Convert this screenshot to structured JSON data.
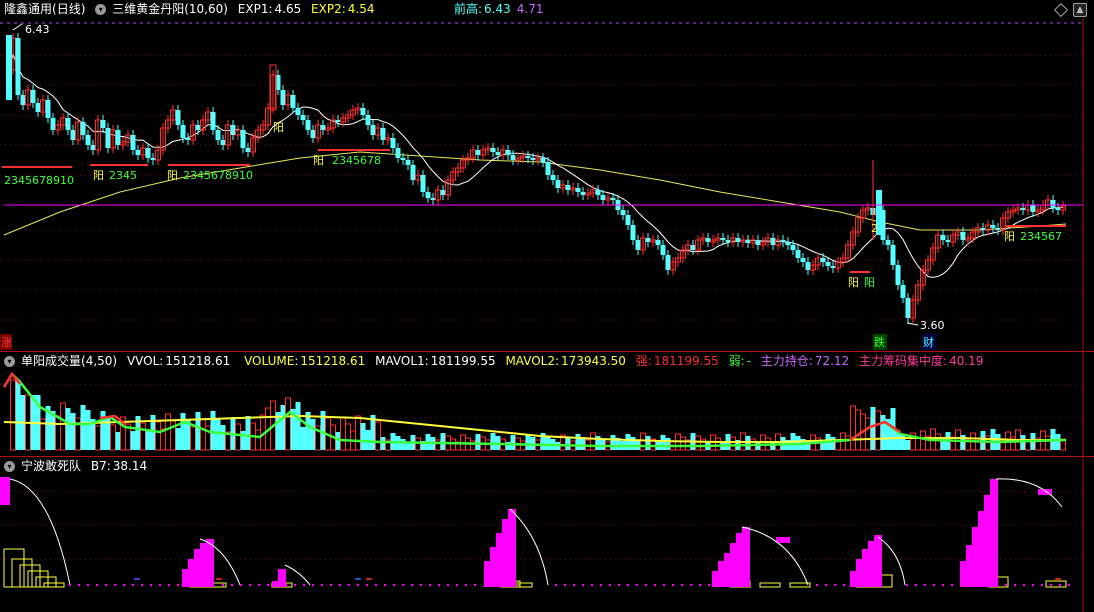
{
  "main": {
    "title": "隆鑫通用",
    "period": "(日线)",
    "indicator_name": "三维黄金丹阳",
    "indicator_params": "(10,60)",
    "exp1_label": "EXP1:",
    "exp1_value": "4.65",
    "exp2_label": "EXP2:",
    "exp2_value": "4.54",
    "prev_high_label": "前高:",
    "prev_high_value1": "6.43",
    "prev_high_value2": "4.71",
    "high_marker": "6.43",
    "low_marker": "3.60",
    "zhang_label": "涨",
    "die_label": "跌",
    "cai_label": "财",
    "signals": [
      {
        "label": "2345678910"
      },
      {
        "label": "阳"
      },
      {
        "label": "2345"
      },
      {
        "label": "阳"
      },
      {
        "label": "2345678910"
      },
      {
        "label": "阳"
      },
      {
        "label": "阳"
      },
      {
        "label": "2345678"
      },
      {
        "label": "阳"
      },
      {
        "label": "阳"
      },
      {
        "label": "2"
      },
      {
        "label": "阳"
      },
      {
        "label": "234567"
      }
    ]
  },
  "volume": {
    "name": "单阳成交量",
    "params": "(4,50)",
    "vvol_label": "VVOL:",
    "vvol_value": "151218.61",
    "volume_label": "VOLUME:",
    "volume_value": "151218.61",
    "mavol1_label": "MAVOL1:",
    "mavol1_value": "181199.55",
    "mavol2_label": "MAVOL2:",
    "mavol2_value": "173943.50",
    "strong_label": "强:",
    "strong_value": "181199.55",
    "weak_label": "弱:",
    "weak_value": "-",
    "holding_label": "主力持仓:",
    "holding_value": "72.12",
    "concentration_label": "主力筹码集中度:",
    "concentration_value": "40.19"
  },
  "bottom": {
    "name": "宁波敢死队",
    "b7_label": "B7:",
    "b7_value": "38.14"
  },
  "colors": {
    "up": "#ff3030",
    "down": "#54ffff",
    "ma_short": "#ffffff",
    "ma_long": "#e8e85a",
    "level_line": "#ff00ff",
    "grid": "#8a1010",
    "signal_green": "#3cff3c",
    "signal_yellow": "#ffff3c",
    "magenta": "#ff00ff",
    "white": "#ffffff",
    "strong_red": "#ff3030",
    "weak_green": "#3cff3c",
    "holding_purple": "#cc66ff",
    "concentration_pink": "#ff3c9a"
  },
  "icons": {
    "title_toggle": "circle-toggle-icon",
    "diamond": "diamond-icon",
    "maximize": "maximize-icon"
  }
}
